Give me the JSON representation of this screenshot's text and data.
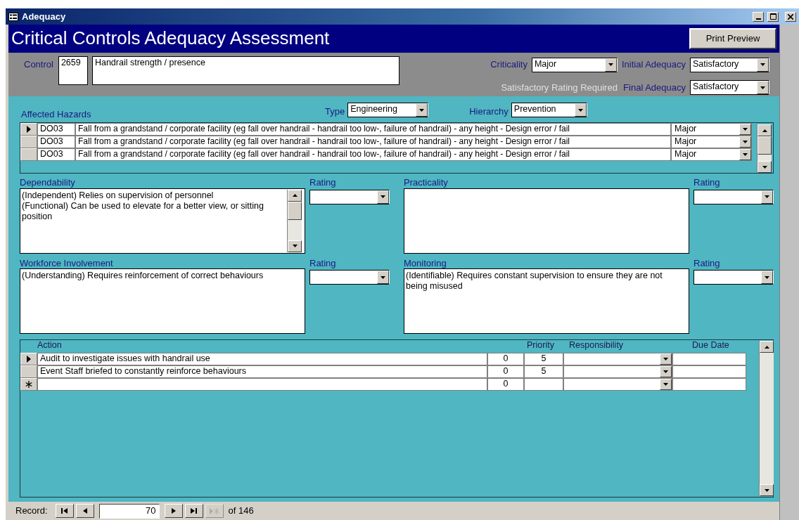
{
  "window": {
    "title": "Adequacy"
  },
  "header": {
    "title": "Critical Controls Adequacy Assessment",
    "button": "Print Preview"
  },
  "control": {
    "label": "Control",
    "number": "2659",
    "name": "Handrail strength / presence"
  },
  "criticality": {
    "label": "Criticality",
    "value": "Major"
  },
  "initial_adequacy": {
    "label": "Initial Adequacy",
    "value": "Satisfactory"
  },
  "rating_note": "Satisfactory Rating Required",
  "final_adequacy": {
    "label": "Final Adequacy",
    "value": "Satisfactory"
  },
  "affected_hazards": {
    "label": "Affected Hazards",
    "rows": [
      {
        "selected": true,
        "code": "DO03",
        "description": "Fall from a grandstand / corporate facility (eg fall over handrail - handrail too low-, failure of handrail) - any height - Design error / fail",
        "severity": "Major"
      },
      {
        "selected": false,
        "code": "DO03",
        "description": "Fall from a grandstand / corporate facility (eg fall over handrail - handrail too low-, failure of handrail) - any height - Design error / fail",
        "severity": "Major"
      },
      {
        "selected": false,
        "code": "DO03",
        "description": "Fall from a grandstand / corporate facility (eg fall over handrail - handrail too low-, failure of handrail) - any height - Design error / fail",
        "severity": "Major"
      }
    ]
  },
  "type": {
    "label": "Type",
    "value": "Engineering"
  },
  "hierarchy": {
    "label": "Hierarchy",
    "value": "Prevention"
  },
  "assessments": [
    {
      "label": "Dependability",
      "text": "(Independent) Relies on supervision of personnel\n(Functional) Can be used to elevate for a better view, or sitting position",
      "scrollbar": true,
      "rating_label": "Rating"
    },
    {
      "label": "Practicality",
      "scrollbar": false,
      "rating_label": "Rating"
    },
    {
      "label": "Workforce Involvement",
      "text": "(Understanding) Requires reinforcement of correct behaviours",
      "scrollbar": false,
      "rating_label": "Rating"
    },
    {
      "label": "Monitoring",
      "text": "(Identifiable) Requires constant supervision to ensure they are not being misused",
      "scrollbar": false,
      "rating_label": "Rating"
    }
  ],
  "actions": {
    "columns": {
      "action": "Action",
      "priority": "Priority",
      "responsibility": "Responsibility",
      "due_date": "Due Date"
    },
    "rows": [
      {
        "kind": "record",
        "selected": true,
        "action": "Audit to investigate issues with handrail use",
        "column_2": "0",
        "priority": "5"
      },
      {
        "kind": "record",
        "selected": false,
        "action": "Event Staff briefed to constantly reinforce behaviours",
        "column_2": "0",
        "priority": "5"
      },
      {
        "kind": "new",
        "selected": false,
        "column_2": "0"
      }
    ]
  },
  "record_nav": {
    "label": "Record:",
    "current": "70",
    "total": "of 146",
    "new_disabled": true
  }
}
